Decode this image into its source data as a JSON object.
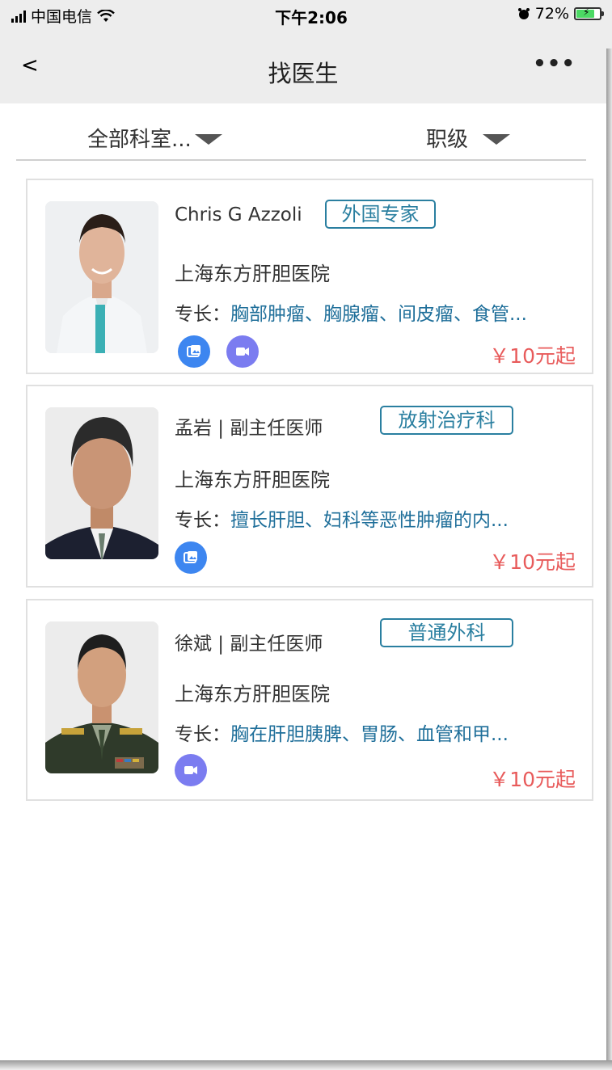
{
  "status_bar": {
    "carrier": "中国电信",
    "time": "下午2:06",
    "battery": "72%"
  },
  "navbar": {
    "back": "<",
    "title": "找医生",
    "more": "•••"
  },
  "filters": {
    "department": "全部科室...",
    "level": "职级"
  },
  "doctors": [
    {
      "name": "Chris G Azzoli",
      "tag": "外国专家",
      "hospital": "上海东方肝胆医院",
      "specialty_label": "专长：",
      "specialty": "胸部肿瘤、胸腺瘤、间皮瘤、食管...",
      "price": "￥10元起",
      "services": [
        "image-consult",
        "video-consult"
      ]
    },
    {
      "name": "孟岩 | 副主任医师",
      "tag": "放射治疗科",
      "hospital": "上海东方肝胆医院",
      "specialty_label": "专长：",
      "specialty": "擅长肝胆、妇科等恶性肿瘤的内...",
      "price": "￥10元起",
      "services": [
        "image-consult"
      ]
    },
    {
      "name": "徐斌 | 副主任医师",
      "tag": "普通外科",
      "hospital": "上海东方肝胆医院",
      "specialty_label": "专长：",
      "specialty": "胸在肝胆胰脾、胃肠、血管和甲...",
      "price": "￥10元起",
      "services": [
        "video-consult"
      ]
    }
  ],
  "colors": {
    "accent": "#2a7fa0",
    "price": "#e85b5b",
    "image_consult": "#3d86f0",
    "video_consult": "#7b7cf0"
  }
}
